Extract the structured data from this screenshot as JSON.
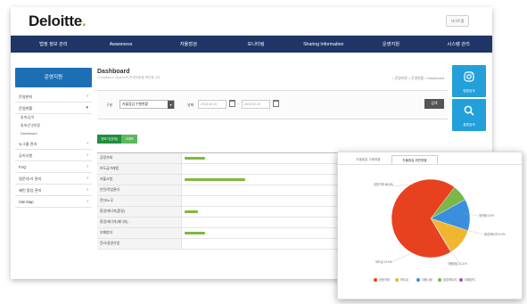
{
  "header": {
    "logo": "Deloitte",
    "logo_dot": ".",
    "top_button": "사이트맵"
  },
  "nav": [
    "법정 정보 관리",
    "Awareness",
    "자율점검",
    "모니터링",
    "Sharing Information",
    "운영지원",
    "시스템 관리"
  ],
  "sidebar": {
    "title": "운영지원",
    "items": [
      {
        "label": "운영현지"
      },
      {
        "label": "운영현황",
        "subs": [
          "통계/검색",
          "통계/운영현황",
          "Dashboard"
        ]
      },
      {
        "label": "뉴그룹 관리"
      },
      {
        "label": "공지사항"
      },
      {
        "label": "FAQ"
      },
      {
        "label": "질문/추가 관리"
      },
      {
        "label": "혜민 팝업 관리"
      },
      {
        "label": "Site Map"
      }
    ]
  },
  "page": {
    "title": "Dashboard",
    "subtitle": "Compliance System의 운영현황을 확인합니다.",
    "breadcrumb": "⌂ 운영지원 > 운영현황 > Dashboard"
  },
  "filter": {
    "label1": "구분",
    "select": "자율점검 수행현황",
    "label2": "날짜",
    "date_from": "2015.02.20",
    "date_to": "2015.02.20",
    "button": "검색"
  },
  "tabs": [
    "표보기(전체)",
    "그래프"
  ],
  "table_rows": [
    {
      "label": "공정거래",
      "value": 0.06
    },
    {
      "label": "하도급거래법",
      "value": 0.0
    },
    {
      "label": "자율시험",
      "value": 0.18
    },
    {
      "label": "안전/작업관리",
      "value": 0.0
    },
    {
      "label": "전자/노무",
      "value": 0.0
    },
    {
      "label": "환경/에너지(환경)",
      "value": 0.04
    },
    {
      "label": "환경/에너지(에너지)",
      "value": 0.0
    },
    {
      "label": "부패방지",
      "value": 0.06
    },
    {
      "label": "윤리/경영기법",
      "value": 0.0
    }
  ],
  "quick_buttons": [
    {
      "label": "법령검색",
      "icon": "instagram-icon"
    },
    {
      "label": "통합검색",
      "icon": "search-icon"
    }
  ],
  "popup": {
    "tabs": [
      "자율점검 수행현황",
      "자율점검 위반현황"
    ],
    "active_tab": 1
  },
  "chart_data": {
    "type": "pie",
    "slices": [
      {
        "label": "공정거래",
        "value": 68.9,
        "color": "#e8411f"
      },
      {
        "label": "위반",
        "value": 11.1,
        "color": "#f1b630"
      },
      {
        "label": "자율점검",
        "value": 13.0,
        "color": "#3a8fdc"
      },
      {
        "label": "자율준수",
        "value": 6.7,
        "color": "#7ab648"
      },
      {
        "label": "하도급",
        "value": 0.3,
        "color": "#9b59b6"
      }
    ],
    "slice_labels": [
      "공정거래 68.9%",
      "위반율 0.0%",
      "환경/에너지 0.0%",
      "자율점검 11.1%",
      "하도급 13.0%"
    ],
    "legend": [
      "공정거래",
      "하도급",
      "자율시험",
      "환경/에너지",
      "부패방지"
    ]
  }
}
